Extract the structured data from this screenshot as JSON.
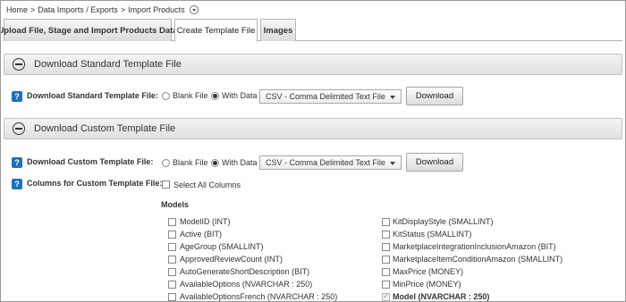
{
  "breadcrumb": {
    "home": "Home",
    "separator": ">",
    "data_imports_exports": "Data Imports / Exports",
    "import_products": "Import Products"
  },
  "tabs": [
    {
      "label": "Upload File, Stage and Import Products Data"
    },
    {
      "label": "Create Template File"
    },
    {
      "label": "Images"
    }
  ],
  "standard_section": {
    "header": "Download Standard Template File",
    "help": "?",
    "label": "Download Standard Template File:",
    "blank_file": "Blank File",
    "with_data": "With Data",
    "selected_option": "With Data",
    "format": "CSV - Comma Delimited Text File",
    "download_button": "Download"
  },
  "custom_section": {
    "header": "Download Custom Template File",
    "help": "?",
    "label": "Download Custom Template File:",
    "blank_file": "Blank File",
    "with_data": "With Data",
    "selected_option": "With Data",
    "format": "CSV - Comma Delimited Text File",
    "download_button": "Download",
    "columns_label": "Columns for Custom Template File:",
    "select_all": "Select All Columns",
    "models_heading": "Models",
    "left_columns": [
      "ModelID (INT)",
      "Active (BIT)",
      "AgeGroup (SMALLINT)",
      "ApprovedReviewCount (INT)",
      "AutoGenerateShortDescription (BIT)",
      "AvailableOptions (NVARCHAR : 250)",
      "AvailableOptionsFrench (NVARCHAR : 250)"
    ],
    "right_columns": [
      "KitDisplayStyle (SMALLINT)",
      "KitStatus (SMALLINT)",
      "MarketplaceIntegrationInclusionAmazon (BIT)",
      "MarketplaceItemConditionAmazon (SMALLINT)",
      "MaxPrice (MONEY)",
      "MinPrice (MONEY)",
      "Model (NVARCHAR : 250)"
    ],
    "required_column": "Model (NVARCHAR : 250)"
  },
  "colors": {
    "help_icon": "#1a72c6",
    "section_header_bg": "#e8e8e8",
    "border": "#b5b5b5"
  },
  "icons": {
    "breadcrumb_toggle": "chevron-down-circle-icon",
    "section_toggle": "minus-circle-icon",
    "help": "question-icon",
    "dropdown": "caret-down-icon"
  }
}
